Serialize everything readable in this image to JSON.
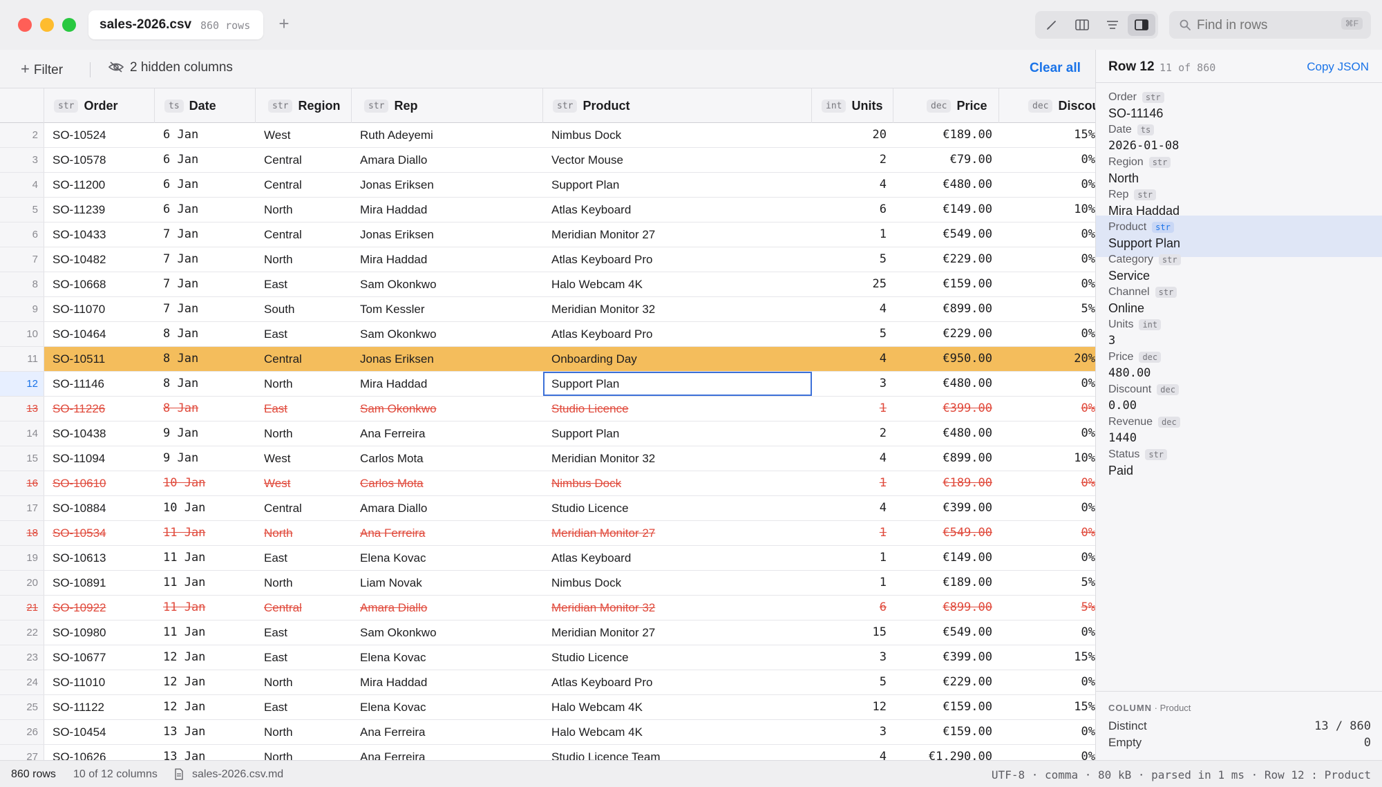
{
  "window": {
    "file_name": "sales-2026.csv",
    "row_count_label": "860 rows",
    "new_tab": "+",
    "search_placeholder": "Find in rows",
    "search_shortcut": "⌘F"
  },
  "filterbar": {
    "filter_label": "Filter",
    "hidden_label": "2 hidden columns",
    "clear_label": "Clear all"
  },
  "columns": [
    {
      "type": "str",
      "label": "Order"
    },
    {
      "type": "ts",
      "label": "Date"
    },
    {
      "type": "str",
      "label": "Region"
    },
    {
      "type": "str",
      "label": "Rep"
    },
    {
      "type": "str",
      "label": "Product"
    },
    {
      "type": "int",
      "label": "Units"
    },
    {
      "type": "dec",
      "label": "Price"
    },
    {
      "type": "dec",
      "label": "Discount"
    }
  ],
  "rows": [
    {
      "n": "2",
      "order": "SO-10524",
      "date": "6 Jan",
      "region": "West",
      "rep": "Ruth Adeyemi",
      "product": "Nimbus Dock",
      "units": "20",
      "price": "€189.00",
      "discount": "15%",
      "state": ""
    },
    {
      "n": "3",
      "order": "SO-10578",
      "date": "6 Jan",
      "region": "Central",
      "rep": "Amara Diallo",
      "product": "Vector Mouse",
      "units": "2",
      "price": "€79.00",
      "discount": "0%",
      "state": ""
    },
    {
      "n": "4",
      "order": "SO-11200",
      "date": "6 Jan",
      "region": "Central",
      "rep": "Jonas Eriksen",
      "product": "Support Plan",
      "units": "4",
      "price": "€480.00",
      "discount": "0%",
      "state": ""
    },
    {
      "n": "5",
      "order": "SO-11239",
      "date": "6 Jan",
      "region": "North",
      "rep": "Mira Haddad",
      "product": "Atlas Keyboard",
      "units": "6",
      "price": "€149.00",
      "discount": "10%",
      "state": ""
    },
    {
      "n": "6",
      "order": "SO-10433",
      "date": "7 Jan",
      "region": "Central",
      "rep": "Jonas Eriksen",
      "product": "Meridian Monitor 27",
      "units": "1",
      "price": "€549.00",
      "discount": "0%",
      "state": ""
    },
    {
      "n": "7",
      "order": "SO-10482",
      "date": "7 Jan",
      "region": "North",
      "rep": "Mira Haddad",
      "product": "Atlas Keyboard Pro",
      "units": "5",
      "price": "€229.00",
      "discount": "0%",
      "state": ""
    },
    {
      "n": "8",
      "order": "SO-10668",
      "date": "7 Jan",
      "region": "East",
      "rep": "Sam Okonkwo",
      "product": "Halo Webcam 4K",
      "units": "25",
      "price": "€159.00",
      "discount": "0%",
      "state": ""
    },
    {
      "n": "9",
      "order": "SO-11070",
      "date": "7 Jan",
      "region": "South",
      "rep": "Tom Kessler",
      "product": "Meridian Monitor 32",
      "units": "4",
      "price": "€899.00",
      "discount": "5%",
      "state": ""
    },
    {
      "n": "10",
      "order": "SO-10464",
      "date": "8 Jan",
      "region": "East",
      "rep": "Sam Okonkwo",
      "product": "Atlas Keyboard Pro",
      "units": "5",
      "price": "€229.00",
      "discount": "0%",
      "state": ""
    },
    {
      "n": "11",
      "order": "SO-10511",
      "date": "8 Jan",
      "region": "Central",
      "rep": "Jonas Eriksen",
      "product": "Onboarding Day",
      "units": "4",
      "price": "€950.00",
      "discount": "20%",
      "state": "hl"
    },
    {
      "n": "12",
      "order": "SO-11146",
      "date": "8 Jan",
      "region": "North",
      "rep": "Mira Haddad",
      "product": "Support Plan",
      "units": "3",
      "price": "€480.00",
      "discount": "0%",
      "state": "cur"
    },
    {
      "n": "13",
      "order": "SO-11226",
      "date": "8 Jan",
      "region": "East",
      "rep": "Sam Okonkwo",
      "product": "Studio Licence",
      "units": "1",
      "price": "€399.00",
      "discount": "0%",
      "state": "striked"
    },
    {
      "n": "14",
      "order": "SO-10438",
      "date": "9 Jan",
      "region": "North",
      "rep": "Ana Ferreira",
      "product": "Support Plan",
      "units": "2",
      "price": "€480.00",
      "discount": "0%",
      "state": ""
    },
    {
      "n": "15",
      "order": "SO-11094",
      "date": "9 Jan",
      "region": "West",
      "rep": "Carlos Mota",
      "product": "Meridian Monitor 32",
      "units": "4",
      "price": "€899.00",
      "discount": "10%",
      "state": ""
    },
    {
      "n": "16",
      "order": "SO-10610",
      "date": "10 Jan",
      "region": "West",
      "rep": "Carlos Mota",
      "product": "Nimbus Dock",
      "units": "1",
      "price": "€189.00",
      "discount": "0%",
      "state": "striked"
    },
    {
      "n": "17",
      "order": "SO-10884",
      "date": "10 Jan",
      "region": "Central",
      "rep": "Amara Diallo",
      "product": "Studio Licence",
      "units": "4",
      "price": "€399.00",
      "discount": "0%",
      "state": ""
    },
    {
      "n": "18",
      "order": "SO-10534",
      "date": "11 Jan",
      "region": "North",
      "rep": "Ana Ferreira",
      "product": "Meridian Monitor 27",
      "units": "1",
      "price": "€549.00",
      "discount": "0%",
      "state": "striked"
    },
    {
      "n": "19",
      "order": "SO-10613",
      "date": "11 Jan",
      "region": "East",
      "rep": "Elena Kovac",
      "product": "Atlas Keyboard",
      "units": "1",
      "price": "€149.00",
      "discount": "0%",
      "state": ""
    },
    {
      "n": "20",
      "order": "SO-10891",
      "date": "11 Jan",
      "region": "North",
      "rep": "Liam Novak",
      "product": "Nimbus Dock",
      "units": "1",
      "price": "€189.00",
      "discount": "5%",
      "state": ""
    },
    {
      "n": "21",
      "order": "SO-10922",
      "date": "11 Jan",
      "region": "Central",
      "rep": "Amara Diallo",
      "product": "Meridian Monitor 32",
      "units": "6",
      "price": "€899.00",
      "discount": "5%",
      "state": "striked"
    },
    {
      "n": "22",
      "order": "SO-10980",
      "date": "11 Jan",
      "region": "East",
      "rep": "Sam Okonkwo",
      "product": "Meridian Monitor 27",
      "units": "15",
      "price": "€549.00",
      "discount": "0%",
      "state": ""
    },
    {
      "n": "23",
      "order": "SO-10677",
      "date": "12 Jan",
      "region": "East",
      "rep": "Elena Kovac",
      "product": "Studio Licence",
      "units": "3",
      "price": "€399.00",
      "discount": "15%",
      "state": ""
    },
    {
      "n": "24",
      "order": "SO-11010",
      "date": "12 Jan",
      "region": "North",
      "rep": "Mira Haddad",
      "product": "Atlas Keyboard Pro",
      "units": "5",
      "price": "€229.00",
      "discount": "0%",
      "state": ""
    },
    {
      "n": "25",
      "order": "SO-11122",
      "date": "12 Jan",
      "region": "East",
      "rep": "Elena Kovac",
      "product": "Halo Webcam 4K",
      "units": "12",
      "price": "€159.00",
      "discount": "15%",
      "state": ""
    },
    {
      "n": "26",
      "order": "SO-10454",
      "date": "13 Jan",
      "region": "North",
      "rep": "Ana Ferreira",
      "product": "Halo Webcam 4K",
      "units": "3",
      "price": "€159.00",
      "discount": "0%",
      "state": ""
    },
    {
      "n": "27",
      "order": "SO-10626",
      "date": "13 Jan",
      "region": "North",
      "rep": "Ana Ferreira",
      "product": "Studio Licence Team",
      "units": "4",
      "price": "€1,290.00",
      "discount": "0%",
      "state": ""
    }
  ],
  "inspector": {
    "title": "Row 12",
    "count": "11 of 860",
    "copy_label": "Copy JSON",
    "fields": [
      {
        "name": "Order",
        "type": "str",
        "value": "SO-11146",
        "mono": false
      },
      {
        "name": "Date",
        "type": "ts",
        "value": "2026-01-08",
        "mono": true
      },
      {
        "name": "Region",
        "type": "str",
        "value": "North",
        "mono": false
      },
      {
        "name": "Rep",
        "type": "str",
        "value": "Mira Haddad",
        "mono": false
      },
      {
        "name": "Product",
        "type": "str",
        "value": "Support Plan",
        "mono": false
      },
      {
        "name": "Category",
        "type": "str",
        "value": "Service",
        "mono": false
      },
      {
        "name": "Channel",
        "type": "str",
        "value": "Online",
        "mono": false
      },
      {
        "name": "Units",
        "type": "int",
        "value": "3",
        "mono": true
      },
      {
        "name": "Price",
        "type": "dec",
        "value": "480.00",
        "mono": true
      },
      {
        "name": "Discount",
        "type": "dec",
        "value": "0.00",
        "mono": true
      },
      {
        "name": "Revenue",
        "type": "dec",
        "value": "1440",
        "mono": true
      },
      {
        "name": "Status",
        "type": "str",
        "value": "Paid",
        "mono": false
      }
    ],
    "column_stats": {
      "label": "COLUMN",
      "column": "Product",
      "distinct_label": "Distinct",
      "distinct_value": "13 / 860",
      "empty_label": "Empty",
      "empty_value": "0"
    }
  },
  "status": {
    "rows": "860 rows",
    "columns": "10 of 12 columns",
    "file": "sales-2026.csv.md",
    "right": "UTF-8 · comma · 80 kB · parsed in 1 ms · Row 12 : Product"
  },
  "colors": {
    "accent": "#1a73e8",
    "highlight_row": "#f4bd5c",
    "strike": "#e04a3c",
    "close": "#ff5f57",
    "minimize": "#febc2e",
    "zoom": "#28c840"
  }
}
